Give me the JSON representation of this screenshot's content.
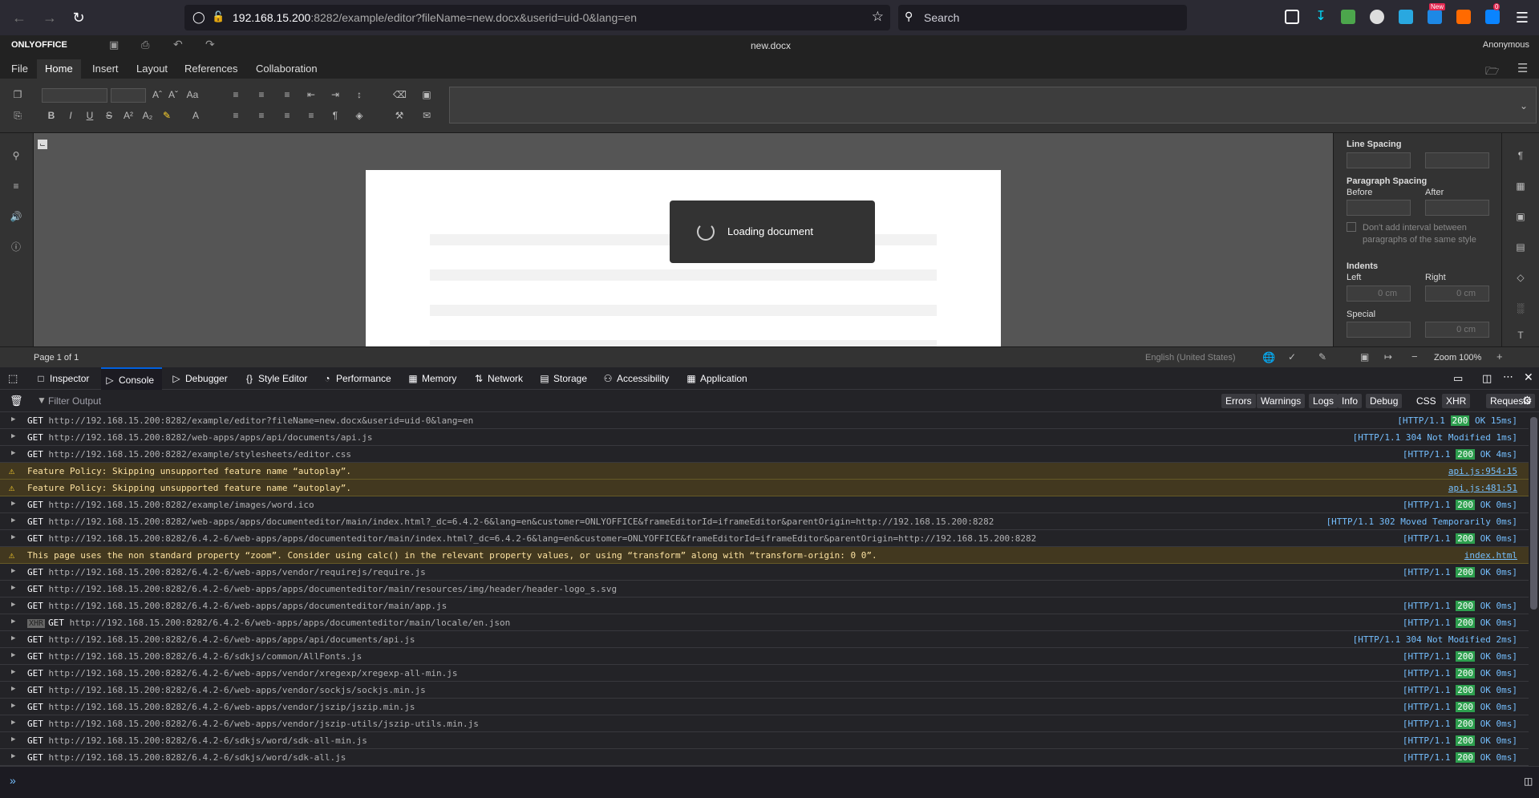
{
  "browser": {
    "url_host": "192.168.15.200",
    "url_rest": ":8282/example/editor?fileName=new.docx&userid=uid-0&lang=en",
    "search_placeholder": "Search",
    "ext_badge": "0",
    "new_badge": "New"
  },
  "editor": {
    "brand": "ONLYOFFICE",
    "doc_title": "new.docx",
    "user": "Anonymous",
    "tabs": [
      "File",
      "Home",
      "Insert",
      "Layout",
      "References",
      "Collaboration"
    ],
    "active_tab": "Home",
    "loading_text": "Loading document",
    "page_info": "Page 1 of 1",
    "language": "English (United States)",
    "zoom": "Zoom 100%",
    "right_panel": {
      "line_spacing": "Line Spacing",
      "paragraph_spacing": "Paragraph Spacing",
      "before": "Before",
      "after": "After",
      "no_interval": "Don't add interval between paragraphs of the same style",
      "indents": "Indents",
      "left": "Left",
      "right": "Right",
      "left_val": "0 cm",
      "right_val": "0 cm",
      "special": "Special",
      "special_val": "0 cm"
    }
  },
  "devtools": {
    "tabs": [
      {
        "label": "Inspector",
        "icon": "inspector-icon"
      },
      {
        "label": "Console",
        "icon": "console-icon"
      },
      {
        "label": "Debugger",
        "icon": "debugger-icon"
      },
      {
        "label": "Style Editor",
        "icon": "style-editor-icon"
      },
      {
        "label": "Performance",
        "icon": "performance-icon"
      },
      {
        "label": "Memory",
        "icon": "memory-icon"
      },
      {
        "label": "Network",
        "icon": "network-icon"
      },
      {
        "label": "Storage",
        "icon": "storage-icon"
      },
      {
        "label": "Accessibility",
        "icon": "accessibility-icon"
      },
      {
        "label": "Application",
        "icon": "application-icon"
      }
    ],
    "active_tab": "Console",
    "filter_placeholder": "Filter Output",
    "filter_buttons": [
      "Errors",
      "Warnings",
      "Logs",
      "Info",
      "Debug"
    ],
    "extra_buttons": [
      "CSS",
      "XHR",
      "Requests"
    ],
    "rows": [
      {
        "type": "get",
        "method": "GET",
        "url": "http://192.168.15.200:8282/example/editor?fileName=new.docx&userid=uid-0&lang=en",
        "proto": "[HTTP/1.1",
        "code": "200",
        "text": "OK 15ms]"
      },
      {
        "type": "get",
        "method": "GET",
        "url": "http://192.168.15.200:8282/web-apps/apps/api/documents/api.js",
        "proto": "[HTTP/1.1",
        "code": "304",
        "text": "Not Modified 1ms]"
      },
      {
        "type": "get",
        "method": "GET",
        "url": "http://192.168.15.200:8282/example/stylesheets/editor.css",
        "proto": "[HTTP/1.1",
        "code": "200",
        "text": "OK 4ms]"
      },
      {
        "type": "warn",
        "message": "Feature Policy: Skipping unsupported feature name “autoplay”.",
        "source": "api.js:954:15"
      },
      {
        "type": "warn",
        "message": "Feature Policy: Skipping unsupported feature name “autoplay”.",
        "source": "api.js:481:51"
      },
      {
        "type": "get",
        "method": "GET",
        "url": "http://192.168.15.200:8282/example/images/word.ico",
        "proto": "[HTTP/1.1",
        "code": "200",
        "text": "OK 0ms]"
      },
      {
        "type": "get",
        "method": "GET",
        "url": "http://192.168.15.200:8282/web-apps/apps/documenteditor/main/index.html?_dc=6.4.2-6&lang=en&customer=ONLYOFFICE&frameEditorId=iframeEditor&parentOrigin=http://192.168.15.200:8282",
        "proto": "[HTTP/1.1",
        "code": "302",
        "text": "Moved Temporarily 0ms]"
      },
      {
        "type": "get",
        "method": "GET",
        "url": "http://192.168.15.200:8282/6.4.2-6/web-apps/apps/documenteditor/main/index.html?_dc=6.4.2-6&lang=en&customer=ONLYOFFICE&frameEditorId=iframeEditor&parentOrigin=http://192.168.15.200:8282",
        "proto": "[HTTP/1.1",
        "code": "200",
        "text": "OK 0ms]"
      },
      {
        "type": "warn",
        "message": "This page uses the non standard property “zoom”. Consider using calc() in the relevant property values, or using “transform” along with “transform-origin: 0 0”.",
        "source": "index.html"
      },
      {
        "type": "get",
        "method": "GET",
        "url": "http://192.168.15.200:8282/6.4.2-6/web-apps/vendor/requirejs/require.js",
        "proto": "[HTTP/1.1",
        "code": "200",
        "text": "OK 0ms]"
      },
      {
        "type": "get",
        "method": "GET",
        "url": "http://192.168.15.200:8282/6.4.2-6/web-apps/apps/documenteditor/main/resources/img/header/header-logo_s.svg",
        "proto": "",
        "code": "",
        "text": ""
      },
      {
        "type": "get",
        "method": "GET",
        "url": "http://192.168.15.200:8282/6.4.2-6/web-apps/apps/documenteditor/main/app.js",
        "proto": "[HTTP/1.1",
        "code": "200",
        "text": "OK 0ms]"
      },
      {
        "type": "xhr",
        "method": "GET",
        "url": "http://192.168.15.200:8282/6.4.2-6/web-apps/apps/documenteditor/main/locale/en.json",
        "proto": "[HTTP/1.1",
        "code": "200",
        "text": "OK 0ms]"
      },
      {
        "type": "get",
        "method": "GET",
        "url": "http://192.168.15.200:8282/6.4.2-6/web-apps/apps/api/documents/api.js",
        "proto": "[HTTP/1.1",
        "code": "304",
        "text": "Not Modified 2ms]"
      },
      {
        "type": "get",
        "method": "GET",
        "url": "http://192.168.15.200:8282/6.4.2-6/sdkjs/common/AllFonts.js",
        "proto": "[HTTP/1.1",
        "code": "200",
        "text": "OK 0ms]"
      },
      {
        "type": "get",
        "method": "GET",
        "url": "http://192.168.15.200:8282/6.4.2-6/web-apps/vendor/xregexp/xregexp-all-min.js",
        "proto": "[HTTP/1.1",
        "code": "200",
        "text": "OK 0ms]"
      },
      {
        "type": "get",
        "method": "GET",
        "url": "http://192.168.15.200:8282/6.4.2-6/web-apps/vendor/sockjs/sockjs.min.js",
        "proto": "[HTTP/1.1",
        "code": "200",
        "text": "OK 0ms]"
      },
      {
        "type": "get",
        "method": "GET",
        "url": "http://192.168.15.200:8282/6.4.2-6/web-apps/vendor/jszip/jszip.min.js",
        "proto": "[HTTP/1.1",
        "code": "200",
        "text": "OK 0ms]"
      },
      {
        "type": "get",
        "method": "GET",
        "url": "http://192.168.15.200:8282/6.4.2-6/web-apps/vendor/jszip-utils/jszip-utils.min.js",
        "proto": "[HTTP/1.1",
        "code": "200",
        "text": "OK 0ms]"
      },
      {
        "type": "get",
        "method": "GET",
        "url": "http://192.168.15.200:8282/6.4.2-6/sdkjs/word/sdk-all-min.js",
        "proto": "[HTTP/1.1",
        "code": "200",
        "text": "OK 0ms]"
      },
      {
        "type": "get",
        "method": "GET",
        "url": "http://192.168.15.200:8282/6.4.2-6/sdkjs/word/sdk-all.js",
        "proto": "[HTTP/1.1",
        "code": "200",
        "text": "OK 0ms]"
      }
    ]
  }
}
